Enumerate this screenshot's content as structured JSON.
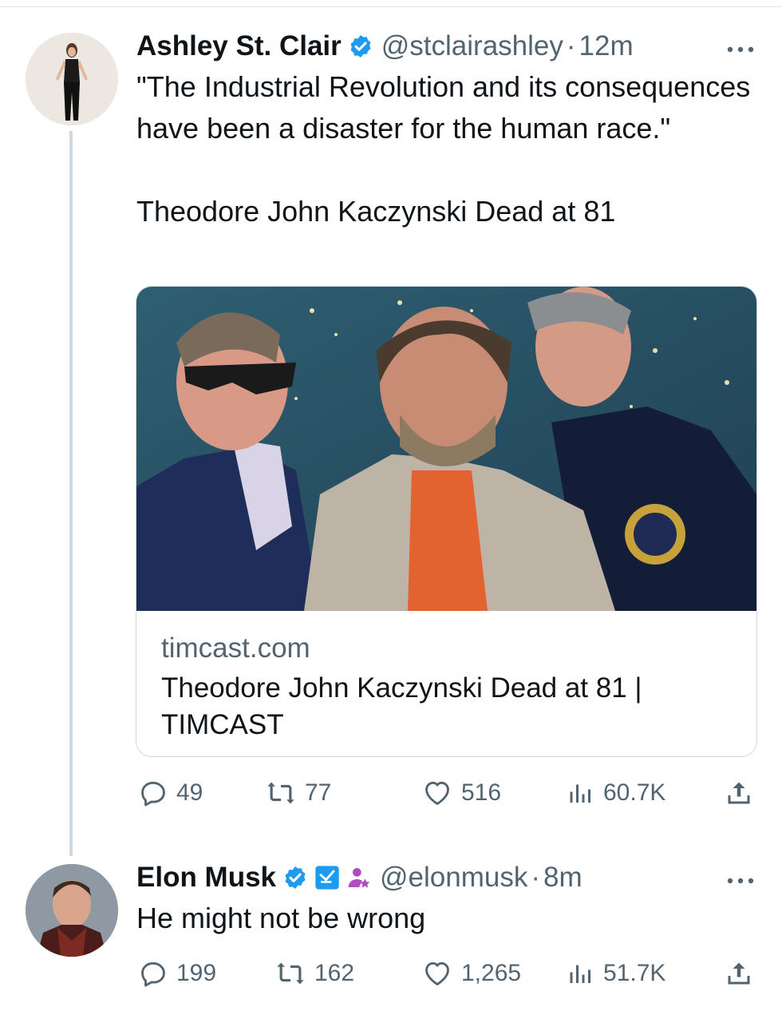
{
  "tweet1": {
    "name": "Ashley St. Clair",
    "handle": "@stclairashley",
    "separator": "·",
    "time": "12m",
    "text": "\"The Industrial Revolution and its consequences have been a disaster for the human race.\"\n\nTheodore John Kaczynski Dead at 81",
    "card": {
      "domain": "timcast.com",
      "title": "Theodore John Kaczynski Dead at 81 | TIMCAST"
    },
    "stats": {
      "replies": "49",
      "reposts": "77",
      "likes": "516",
      "views": "60.7K"
    }
  },
  "tweet2": {
    "name": "Elon Musk",
    "handle": "@elonmusk",
    "separator": "·",
    "time": "8m",
    "text": "He might not be wrong",
    "stats": {
      "replies": "199",
      "reposts": "162",
      "likes": "1,265",
      "views": "51.7K"
    }
  },
  "colors": {
    "verified": "#1d9bf0",
    "muted": "#536471",
    "thread": "#cfd9de",
    "affiliate_purple": "#b24ac2"
  },
  "icons": [
    "more-icon",
    "verified-icon",
    "reply-icon",
    "repost-icon",
    "like-icon",
    "views-icon",
    "share-icon",
    "affiliate-badge-icon",
    "bot-badge-icon"
  ]
}
